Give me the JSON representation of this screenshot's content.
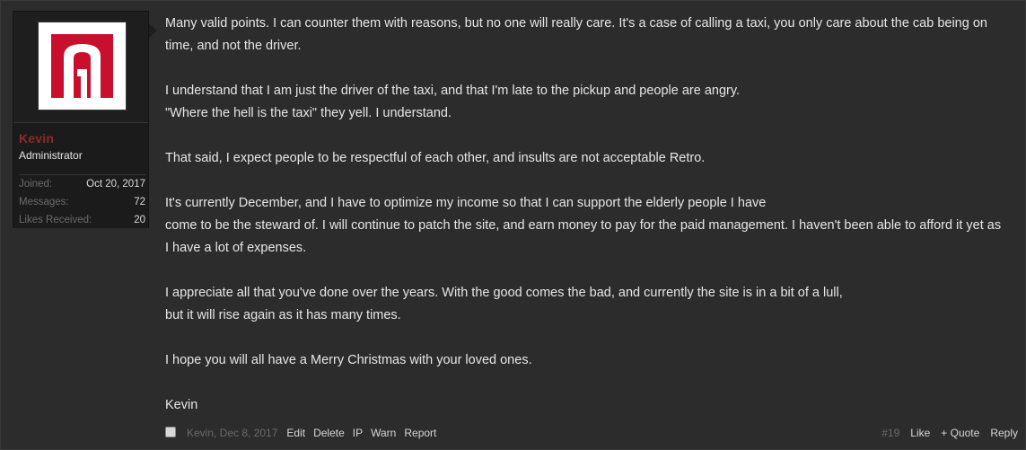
{
  "user": {
    "name": "Kevin",
    "title": "Administrator",
    "stats": [
      {
        "label": "Joined:",
        "value": "Oct 20, 2017"
      },
      {
        "label": "Messages:",
        "value": "72"
      },
      {
        "label": "Likes Received:",
        "value": "20"
      }
    ]
  },
  "message": {
    "paragraphs": [
      "Many valid points. I can counter them with reasons, but no one will really care. It's a case of calling a taxi, you only care about the cab being on time, and not the driver.",
      "I understand that I am just the driver of the taxi, and that I'm late to the pickup and people are angry.\n\"Where the hell is the taxi\" they yell. I understand.",
      "That said, I expect people to be respectful of each other, and insults are not acceptable Retro.",
      "It's currently December, and I have to optimize my income so that I can support the elderly people I have\ncome to be the steward of. I will continue to patch the site, and earn money to pay for the paid management. I haven't been able to afford it yet as I have a lot of expenses.",
      "I appreciate all that you've done over the years. With the good comes the bad, and currently the site is in a bit of a lull,\nbut it will rise again as it has many times.",
      "I hope you will all have a Merry Christmas with your loved ones.",
      "Kevin"
    ]
  },
  "footer": {
    "author_date": "Kevin, Dec 8, 2017",
    "edit": "Edit",
    "delete": "Delete",
    "ip": "IP",
    "warn": "Warn",
    "report": "Report",
    "post_number": "#19",
    "like": "Like",
    "quote": "+ Quote",
    "reply": "Reply"
  },
  "colors": {
    "background": "#2c2c2c",
    "username": "#8d2a2a",
    "muted": "#6b6b6b",
    "text": "#e6e6e6",
    "avatar_red": "#c8102e"
  }
}
